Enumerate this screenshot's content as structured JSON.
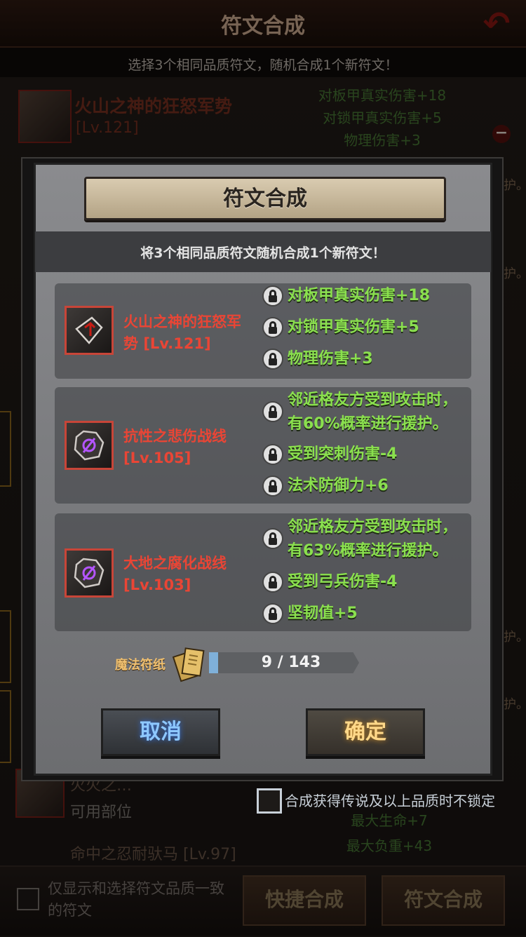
{
  "header": {
    "title": "符文合成",
    "back_icon": "back-arrow-icon"
  },
  "hint": "选择3个相同品质符文，随机合成1个新符文！",
  "bg_selected": {
    "name": "火山之神的狂怒军势",
    "level": "[Lv.121]",
    "stats": [
      "对板甲真实伤害+18",
      "对锁甲真实伤害+5",
      "物理伤害+3"
    ]
  },
  "bg_list": {
    "partial_name": "火火之…",
    "usable_parts_label": "可用部位",
    "row_name": "命中之忍耐驮马 [Lv.97]",
    "right_stats": [
      "最大生命+7",
      "最大负重+43"
    ],
    "edge_text": "护。"
  },
  "lock_option": {
    "label": "合成获得传说及以上品质时不锁定"
  },
  "bottom": {
    "filter_label": "仅显示和选择符文品质一致的符文",
    "quick_button": "快捷合成",
    "compose_button": "符文合成"
  },
  "dialog": {
    "title": "符文合成",
    "description": "将3个相同品质符文随机合成1个新符文！",
    "runes": [
      {
        "name_line1": "火山之神的狂怒军",
        "name_line2": "势",
        "level": "[Lv.121]",
        "icon": "arrow-rune-icon",
        "stats": [
          "对板甲真实伤害+18",
          "对锁甲真实伤害+5",
          "物理伤害+3"
        ]
      },
      {
        "name_line1": "抗性之悲伤战线",
        "level": "[Lv.105]",
        "icon": "purple-slash-rune-icon",
        "stats_multiline": [
          "邻近格友方受到攻击时，",
          "有60%概率进行援护。"
        ],
        "stats": [
          "受到突刺伤害-4",
          "法术防御力+6"
        ]
      },
      {
        "name_line1": "大地之腐化战线",
        "level": "[Lv.103]",
        "icon": "purple-slash-rune-icon",
        "stats_multiline": [
          "邻近格友方受到攻击时，",
          "有63%概率进行援护。"
        ],
        "stats": [
          "受到弓兵伤害-4",
          "坚韧值+5"
        ]
      }
    ],
    "material": {
      "label": "魔法符纸",
      "current": 9,
      "required": 143,
      "display": "9 / 143"
    },
    "cancel": "取消",
    "confirm": "确定"
  },
  "colors": {
    "rune_name": "#ea4535",
    "stat_green": "#8ae04e",
    "material_gold": "#f0c070"
  }
}
